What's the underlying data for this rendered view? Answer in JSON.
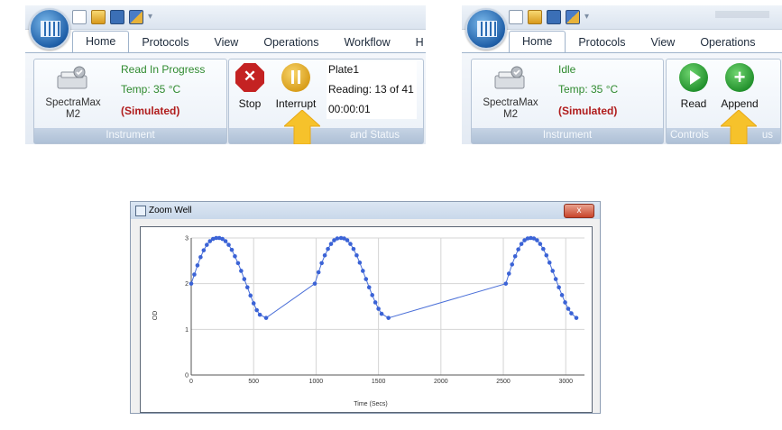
{
  "ribbon_a": {
    "tabs": [
      "Home",
      "Protocols",
      "View",
      "Operations",
      "Workflow",
      "H"
    ],
    "instrument": {
      "name_line1": "SpectraMax",
      "name_line2": "M2",
      "group_title": "Instrument"
    },
    "status": {
      "state": "Read In Progress",
      "temp": "Temp: 35 °C",
      "mode": "(Simulated)"
    },
    "buttons": {
      "stop": "Stop",
      "interrupt": "Interrupt"
    },
    "plate_info": {
      "plate": "Plate1",
      "reading": "Reading: 13 of 41",
      "elapsed": "00:00:01"
    },
    "controls_group_title": "and Status"
  },
  "ribbon_b": {
    "tabs": [
      "Home",
      "Protocols",
      "View",
      "Operations"
    ],
    "instrument": {
      "name_line1": "SpectraMax",
      "name_line2": "M2",
      "group_title": "Instrument"
    },
    "status": {
      "state": "Idle",
      "temp": "Temp: 35 °C",
      "mode": "(Simulated)"
    },
    "buttons": {
      "read": "Read",
      "append": "Append"
    },
    "controls_group_title_left": "Controls",
    "controls_group_title_right": "us"
  },
  "zoom_window": {
    "title": "Zoom Well",
    "close_label": "x"
  },
  "chart_data": {
    "type": "scatter",
    "xlabel": "Time (Secs)",
    "ylabel": "OD",
    "xlim": [
      0,
      3150
    ],
    "ylim": [
      0,
      3
    ],
    "x_ticks": [
      0,
      500,
      1000,
      1500,
      2000,
      2500,
      3000
    ],
    "y_ticks": [
      0,
      1,
      2,
      3
    ],
    "grid": true,
    "series": [
      {
        "color": "#3b63d6",
        "points": [
          [
            0,
            2.0
          ],
          [
            25,
            2.2
          ],
          [
            50,
            2.4
          ],
          [
            75,
            2.58
          ],
          [
            100,
            2.73
          ],
          [
            125,
            2.85
          ],
          [
            150,
            2.93
          ],
          [
            175,
            2.98
          ],
          [
            200,
            3.0
          ],
          [
            225,
            3.0
          ],
          [
            250,
            2.98
          ],
          [
            275,
            2.93
          ],
          [
            300,
            2.85
          ],
          [
            325,
            2.74
          ],
          [
            350,
            2.6
          ],
          [
            375,
            2.45
          ],
          [
            400,
            2.28
          ],
          [
            425,
            2.1
          ],
          [
            450,
            1.92
          ],
          [
            475,
            1.74
          ],
          [
            500,
            1.57
          ],
          [
            525,
            1.42
          ],
          [
            550,
            1.32
          ],
          [
            600,
            1.25
          ],
          [
            990,
            2.0
          ],
          [
            1020,
            2.25
          ],
          [
            1045,
            2.45
          ],
          [
            1070,
            2.62
          ],
          [
            1095,
            2.76
          ],
          [
            1120,
            2.87
          ],
          [
            1145,
            2.95
          ],
          [
            1170,
            2.99
          ],
          [
            1200,
            3.0
          ],
          [
            1225,
            2.99
          ],
          [
            1250,
            2.95
          ],
          [
            1275,
            2.87
          ],
          [
            1300,
            2.76
          ],
          [
            1325,
            2.62
          ],
          [
            1350,
            2.46
          ],
          [
            1375,
            2.28
          ],
          [
            1400,
            2.1
          ],
          [
            1425,
            1.92
          ],
          [
            1450,
            1.75
          ],
          [
            1475,
            1.59
          ],
          [
            1500,
            1.45
          ],
          [
            1525,
            1.34
          ],
          [
            1580,
            1.25
          ],
          [
            2520,
            2.0
          ],
          [
            2545,
            2.22
          ],
          [
            2570,
            2.42
          ],
          [
            2595,
            2.6
          ],
          [
            2620,
            2.75
          ],
          [
            2645,
            2.87
          ],
          [
            2670,
            2.95
          ],
          [
            2695,
            2.99
          ],
          [
            2720,
            3.0
          ],
          [
            2745,
            2.99
          ],
          [
            2770,
            2.95
          ],
          [
            2795,
            2.87
          ],
          [
            2820,
            2.76
          ],
          [
            2845,
            2.62
          ],
          [
            2870,
            2.46
          ],
          [
            2895,
            2.28
          ],
          [
            2920,
            2.1
          ],
          [
            2945,
            1.92
          ],
          [
            2970,
            1.75
          ],
          [
            2995,
            1.59
          ],
          [
            3020,
            1.45
          ],
          [
            3045,
            1.35
          ],
          [
            3085,
            1.25
          ]
        ]
      }
    ]
  }
}
